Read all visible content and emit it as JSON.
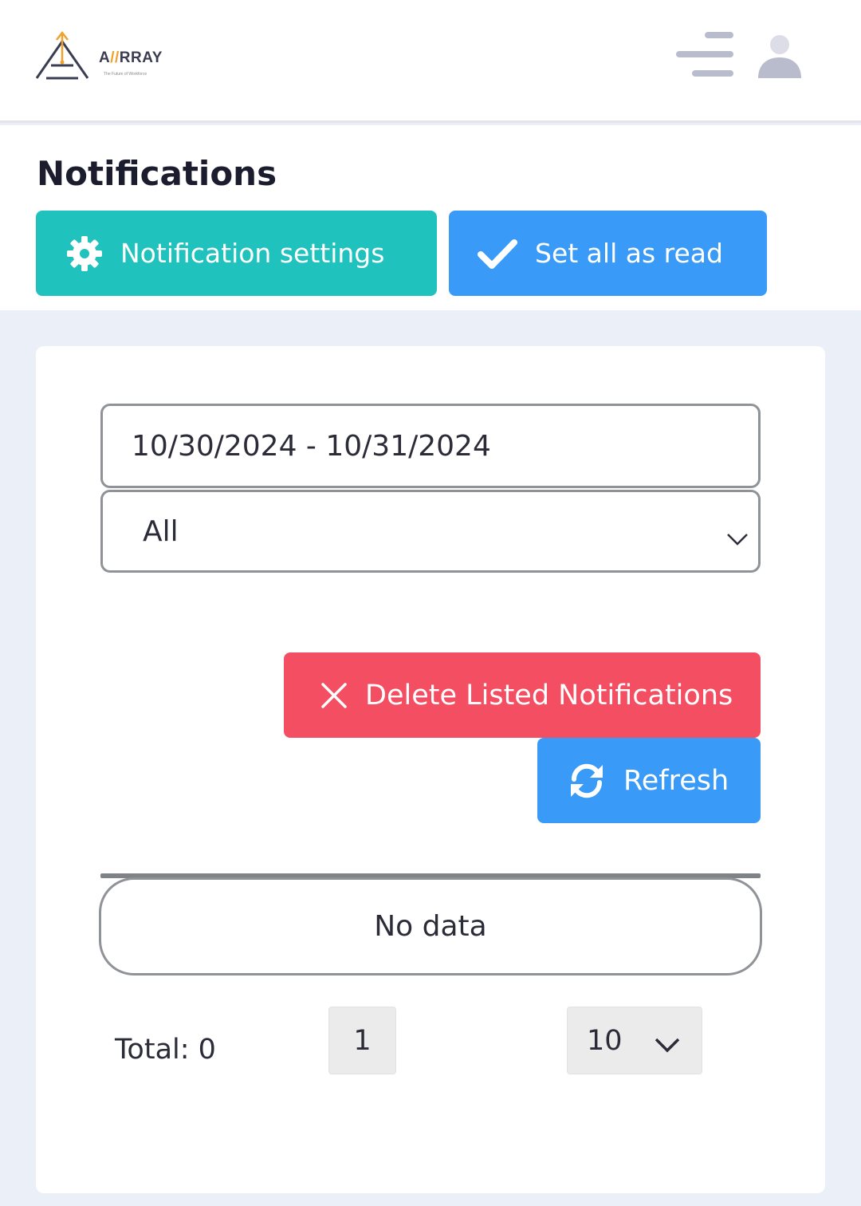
{
  "header": {
    "logo_word_a": "A",
    "logo_word_slash": "//",
    "logo_word_rest": "RRAY",
    "logo_tagline": "The Future of Workforce",
    "menu_icon": "hamburger-menu-icon",
    "user_icon": "user-avatar-icon"
  },
  "page": {
    "title": "Notifications"
  },
  "actions": {
    "settings_label": "Notification settings",
    "settings_icon": "gear-icon",
    "mark_read_label": "Set all as read",
    "mark_read_icon": "check-icon",
    "delete_label": "Delete Listed Notifications",
    "delete_icon": "close-icon",
    "refresh_label": "Refresh",
    "refresh_icon": "sync-icon"
  },
  "filters": {
    "date_range": "10/30/2024 - 10/31/2024",
    "type_selected": "All"
  },
  "table": {
    "empty_text": "No data"
  },
  "pagination": {
    "total_text": "Total: 0",
    "current_page": "1",
    "page_size": "10"
  },
  "colors": {
    "teal": "#20c2bd",
    "blue": "#3a9af7",
    "red": "#f44e62",
    "background": "#ebeff7",
    "logo_accent": "#f0a12c"
  }
}
